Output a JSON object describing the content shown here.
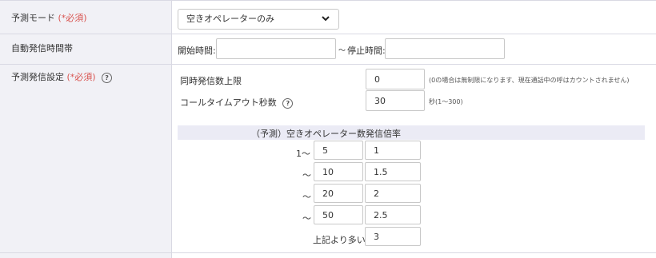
{
  "rows": {
    "predict_mode": {
      "label": "予測モード",
      "required_mark": "(*必須)",
      "select_value": "空きオペレーターのみ"
    },
    "auto_time": {
      "label": "自動発信時間帯",
      "start_label": "開始時間:",
      "separator": "～",
      "stop_label": "停止時間:",
      "start_value": "",
      "stop_value": ""
    },
    "predict_settings": {
      "label": "予測発信設定",
      "required_mark": "(*必須)",
      "concurrent_label": "同時発信数上限",
      "concurrent_value": "0",
      "concurrent_note": "(0の場合は無制限になります、現在通話中の呼はカウントされません)",
      "timeout_label": "コールタイムアウト秒数",
      "timeout_value": "30",
      "timeout_note": "秒(1～300)"
    }
  },
  "ratio_table": {
    "header": "（予測）空きオペレーター数発信倍率",
    "rows": [
      {
        "prefix": "1～",
        "operators": "5",
        "ratio": "1"
      },
      {
        "prefix": "～",
        "operators": "10",
        "ratio": "1.5"
      },
      {
        "prefix": "～",
        "operators": "20",
        "ratio": "2"
      },
      {
        "prefix": "～",
        "operators": "50",
        "ratio": "2.5"
      }
    ],
    "over_label": "上記より多い",
    "over_ratio": "3"
  },
  "icons": {
    "help": "?",
    "chevron": "⌄"
  },
  "colors": {
    "required": "#d9534f",
    "label_bg": "#f1f1f6",
    "table_header_bg": "#ebebf5",
    "border": "#d9d9e3"
  }
}
